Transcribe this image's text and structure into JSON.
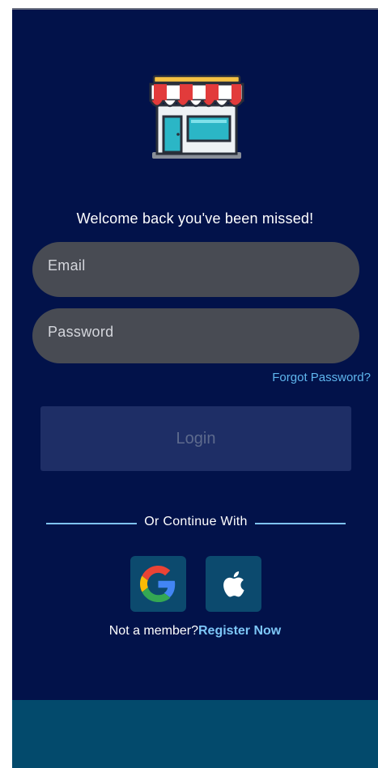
{
  "login": {
    "welcome_text": "Welcome back you've been missed!",
    "email_placeholder": "Email",
    "password_placeholder": "Password",
    "forgot_password": "Forgot Password?",
    "login_button": "Login",
    "divider_text": "Or Continue With",
    "not_member_text": "Not a member?",
    "register_link": "Register Now"
  },
  "social": {
    "google_icon": "google-icon",
    "apple_icon": "apple-icon"
  },
  "colors": {
    "background": "#02124a",
    "field": "#484b53",
    "login_button": "#1e2e66",
    "accent_link": "#7dc6f7",
    "social_tile": "#0c4a6e",
    "bottom_bar": "#034a6c"
  }
}
